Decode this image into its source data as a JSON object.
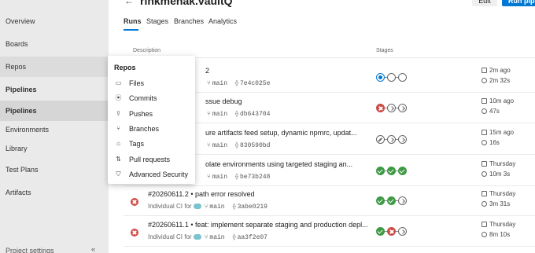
{
  "leftnav": {
    "items": [
      {
        "label": "Overview"
      },
      {
        "label": "Boards"
      },
      {
        "label": "Repos"
      },
      {
        "label": "Pipelines"
      },
      {
        "label": "Pipelines"
      },
      {
        "label": "Environments"
      },
      {
        "label": "Library"
      },
      {
        "label": "Test Plans"
      },
      {
        "label": "Artifacts"
      }
    ],
    "bottom_label": "Project settings",
    "collapse_glyph": "«"
  },
  "header": {
    "back_glyph": "←",
    "title": "rinkmehak.vaultQ",
    "edit_label": "Edit",
    "run_label": "Run pipe"
  },
  "tabs": [
    {
      "label": "Runs"
    },
    {
      "label": "Stages"
    },
    {
      "label": "Branches"
    },
    {
      "label": "Analytics"
    }
  ],
  "table": {
    "col_description": "Description",
    "col_stages": "Stages",
    "rows": [
      {
        "title": "2",
        "meta_prefix": "",
        "branch": "main",
        "commit": "7e4c025e",
        "stages": [
          "running",
          "pending",
          "pending"
        ],
        "time": "2m ago",
        "duration": "2m 32s"
      },
      {
        "title": "ssue debug",
        "meta_prefix": "",
        "branch": "main",
        "commit": "db643704",
        "stages": [
          "fail",
          "partial",
          "partial"
        ],
        "time": "10m ago",
        "duration": "47s"
      },
      {
        "title": "ure artifacts feed setup, dynamic npmrc, updat...",
        "meta_prefix": "",
        "branch": "main",
        "commit": "830590bd",
        "stages": [
          "skip",
          "partial",
          "partial"
        ],
        "time": "15m ago",
        "duration": "16s"
      },
      {
        "title": "olate environments using targeted staging an...",
        "meta_prefix": "",
        "branch": "main",
        "commit": "be73b248",
        "stages": [
          "pass",
          "pass",
          "pass"
        ],
        "time": "Thursday",
        "duration": "10m 3s"
      },
      {
        "title": "#20260611.2 • path error resolved",
        "meta_prefix": "Individual CI for",
        "branch": "main",
        "commit": "3abe0219",
        "stages": [
          "pass",
          "pass",
          "partial"
        ],
        "time": "Thursday",
        "duration": "3m 31s"
      },
      {
        "title": "#20260611.1 • feat: implement separate staging and production depl...",
        "meta_prefix": "Individual CI for",
        "branch": "main",
        "commit": "aa3f2e07",
        "stages": [
          "pass",
          "fail",
          "partial"
        ],
        "time": "Thursday",
        "duration": "8m 10s"
      }
    ]
  },
  "flyout": {
    "title": "Repos",
    "items": [
      {
        "label": "Files",
        "icon": "file-icon",
        "glyph": "▭"
      },
      {
        "label": "Commits",
        "icon": "commit-icon",
        "glyph": "⦿"
      },
      {
        "label": "Pushes",
        "icon": "push-icon",
        "glyph": "⇪"
      },
      {
        "label": "Branches",
        "icon": "branch-icon",
        "glyph": "⑂"
      },
      {
        "label": "Tags",
        "icon": "tag-icon",
        "glyph": "⌂"
      },
      {
        "label": "Pull requests",
        "icon": "pull-request-icon",
        "glyph": "⇅"
      },
      {
        "label": "Advanced Security",
        "icon": "shield-icon",
        "glyph": "⛉"
      }
    ]
  },
  "colors": {
    "accent": "#0078d4",
    "pass": "#3e9a45",
    "fail": "#cd4a45"
  }
}
